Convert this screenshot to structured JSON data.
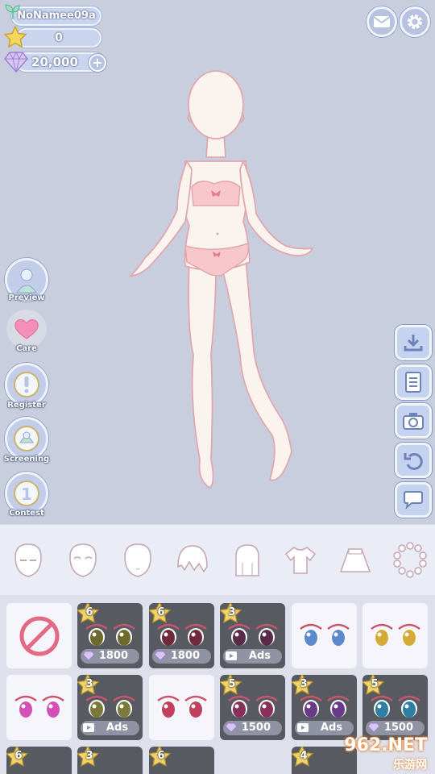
{
  "player": {
    "name": "NoNamee09a",
    "stars": "0",
    "gems": "20,000"
  },
  "left_menu": [
    {
      "label": "Preview",
      "icon": "preview-icon"
    },
    {
      "label": "Care",
      "icon": "heart-icon"
    },
    {
      "label": "Register",
      "icon": "register-icon"
    },
    {
      "label": "Screening",
      "icon": "screening-icon"
    },
    {
      "label": "Contest",
      "icon": "contest-icon"
    }
  ],
  "right_tools": [
    "download-icon",
    "list-icon",
    "camera-icon",
    "undo-icon",
    "speech-bubble-icon"
  ],
  "categories": [
    "eyes",
    "face-expression",
    "face-shape",
    "bangs",
    "hair",
    "top",
    "skirt",
    "necklace"
  ],
  "items": [
    {
      "kind": "none"
    },
    {
      "level": "6",
      "price": "1800",
      "currency": "gem",
      "eye_color": "#6e6a2c"
    },
    {
      "level": "6",
      "price": "1800",
      "currency": "gem",
      "eye_color": "#6e2a3a"
    },
    {
      "level": "3",
      "price": "Ads",
      "currency": "ad",
      "eye_color": "#5a2a4a"
    },
    {
      "kind": "free",
      "eye_color": "#5b88cf"
    },
    {
      "kind": "free",
      "eye_color": "#d6aa38"
    },
    {
      "kind": "free",
      "eye_color": "#d44fb8"
    },
    {
      "level": "3",
      "price": "Ads",
      "currency": "ad",
      "eye_color": "#7b7a3a"
    },
    {
      "kind": "free",
      "eye_color": "#c23f5d"
    },
    {
      "level": "5",
      "price": "1500",
      "currency": "gem",
      "eye_color": "#8a2f5a"
    },
    {
      "level": "3",
      "price": "Ads",
      "currency": "ad",
      "eye_color": "#6a3a8a"
    },
    {
      "level": "5",
      "price": "1500",
      "currency": "gem",
      "eye_color": "#2d7fa6"
    },
    {
      "level": "6"
    },
    {
      "level": "3"
    },
    {
      "level": "6"
    },
    {
      "level": "4"
    }
  ],
  "watermark": {
    "brand": "962.NET",
    "sub": "乐游网"
  }
}
